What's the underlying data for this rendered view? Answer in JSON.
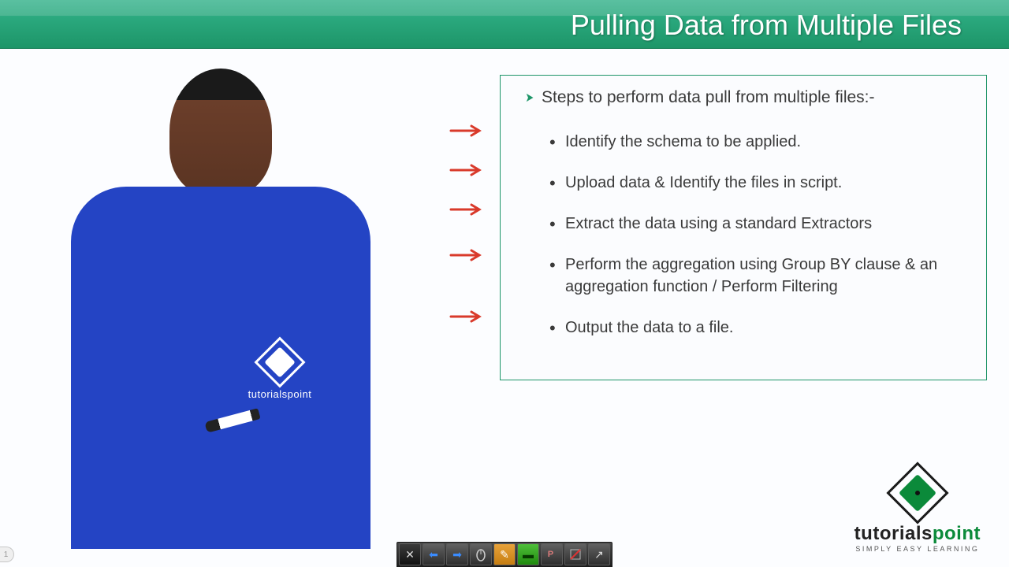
{
  "header": {
    "title": "Pulling Data from Multiple Files"
  },
  "steps": {
    "heading": "Steps to perform data pull from multiple files:-",
    "items": [
      "Identify the schema to be applied.",
      "Upload data & Identify the files in script.",
      "Extract the data using a standard Extractors",
      "Perform the aggregation using Group BY clause & an aggregation function / Perform Filtering",
      "Output the data to a file."
    ]
  },
  "brand": {
    "name_plain": "tutorials",
    "name_accent": "point",
    "tagline": "SIMPLY EASY LEARNING",
    "shirt_text": "tutorialspoint"
  },
  "toolbar": {
    "icons": [
      "close",
      "arrow-left",
      "arrow-right",
      "mouse",
      "pen",
      "highlighter",
      "ppt",
      "pen-off",
      "share"
    ]
  },
  "page_indicator": "1"
}
